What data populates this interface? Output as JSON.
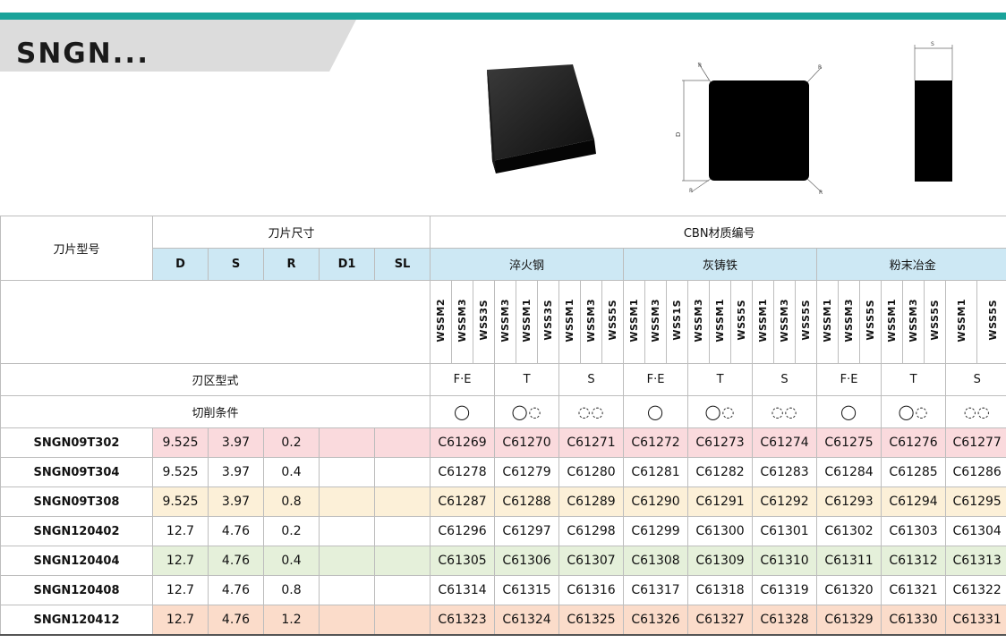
{
  "header": {
    "title": "SNGN..."
  },
  "table": {
    "col_model": "刀片型号",
    "col_dims": "刀片尺寸",
    "col_cbn": "CBN材质编号",
    "dims": [
      "D",
      "S",
      "R",
      "D1",
      "SL"
    ],
    "groups": [
      "淬火钢",
      "灰铸铁",
      "粉末冶金"
    ],
    "grades": [
      "WSSM2",
      "WSSM3",
      "WSS3S",
      "WSSM3",
      "WSSM1",
      "WSS3S",
      "WSSM1",
      "WSSM3",
      "WSS5S",
      "WSSM1",
      "WSSM3",
      "WSS1S",
      "WSSM3",
      "WSSM1",
      "WSS5S",
      "WSSM1",
      "WSSM3",
      "WSS5S",
      "WSSM1",
      "WSSM3",
      "WSS5S",
      "WSSM1",
      "WSSM3",
      "WSS5S",
      "WSSM1",
      "WSS5S"
    ],
    "edge_label": "刃区型式",
    "cond_label": "切削条件",
    "edge_types": [
      "F·E",
      "T",
      "S",
      "F·E",
      "T",
      "S",
      "F·E",
      "T",
      "S"
    ],
    "cond_icons": [
      "◯",
      "◯◌",
      "◌◌",
      "◯",
      "◯◌",
      "◌◌",
      "◯",
      "◯◌",
      "◌◌"
    ],
    "rows": [
      {
        "model": "SNGN09T302",
        "D": "9.525",
        "S": "3.97",
        "R": "0.2",
        "codes": [
          "C61269",
          "C61270",
          "C61271",
          "C61272",
          "C61273",
          "C61274",
          "C61275",
          "C61276",
          "C61277"
        ]
      },
      {
        "model": "SNGN09T304",
        "D": "9.525",
        "S": "3.97",
        "R": "0.4",
        "codes": [
          "C61278",
          "C61279",
          "C61280",
          "C61281",
          "C61282",
          "C61283",
          "C61284",
          "C61285",
          "C61286"
        ]
      },
      {
        "model": "SNGN09T308",
        "D": "9.525",
        "S": "3.97",
        "R": "0.8",
        "codes": [
          "C61287",
          "C61288",
          "C61289",
          "C61290",
          "C61291",
          "C61292",
          "C61293",
          "C61294",
          "C61295"
        ]
      },
      {
        "model": "SNGN120402",
        "D": "12.7",
        "S": "4.76",
        "R": "0.2",
        "codes": [
          "C61296",
          "C61297",
          "C61298",
          "C61299",
          "C61300",
          "C61301",
          "C61302",
          "C61303",
          "C61304"
        ]
      },
      {
        "model": "SNGN120404",
        "D": "12.7",
        "S": "4.76",
        "R": "0.4",
        "codes": [
          "C61305",
          "C61306",
          "C61307",
          "C61308",
          "C61309",
          "C61310",
          "C61311",
          "C61312",
          "C61313"
        ]
      },
      {
        "model": "SNGN120408",
        "D": "12.7",
        "S": "4.76",
        "R": "0.8",
        "codes": [
          "C61314",
          "C61315",
          "C61316",
          "C61317",
          "C61318",
          "C61319",
          "C61320",
          "C61321",
          "C61322"
        ]
      },
      {
        "model": "SNGN120412",
        "D": "12.7",
        "S": "4.76",
        "R": "1.2",
        "codes": [
          "C61323",
          "C61324",
          "C61325",
          "C61326",
          "C61327",
          "C61328",
          "C61329",
          "C61330",
          "C61331"
        ]
      }
    ]
  },
  "drawing": {
    "label_D": "D",
    "label_S": "S",
    "label_R": "R"
  }
}
